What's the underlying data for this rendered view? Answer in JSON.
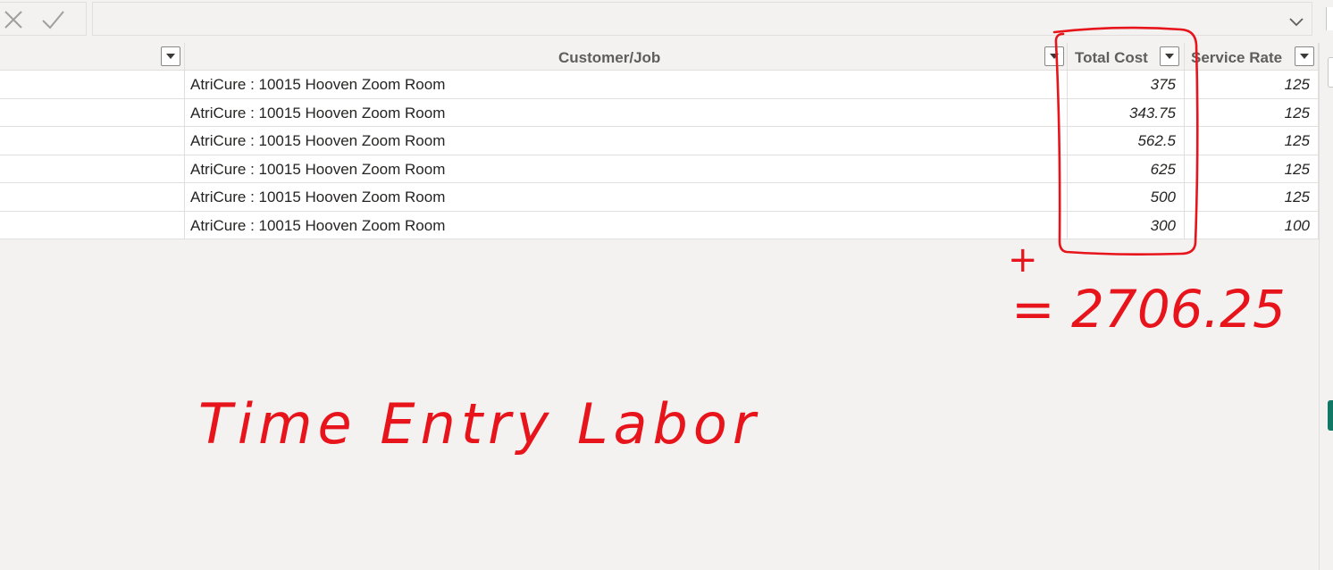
{
  "formula_bar": {
    "cancel_icon": "close-x-icon",
    "commit_icon": "checkmark-icon",
    "expand_icon": "chevron-down-icon",
    "value": ""
  },
  "table": {
    "columns": [
      {
        "label": "",
        "filter_icon": "dropdown-filter-icon"
      },
      {
        "label": "Customer/Job",
        "filter_icon": "dropdown-filter-icon"
      },
      {
        "label": "Total Cost",
        "filter_icon": "dropdown-filter-icon"
      },
      {
        "label": "Service Rate",
        "filter_icon": "dropdown-filter-icon"
      }
    ],
    "rows": [
      {
        "c0": "",
        "customer_job": "AtriCure : 10015 Hooven Zoom Room",
        "total_cost": "375",
        "service_rate": "125"
      },
      {
        "c0": "",
        "customer_job": "AtriCure : 10015 Hooven Zoom Room",
        "total_cost": "343.75",
        "service_rate": "125"
      },
      {
        "c0": "",
        "customer_job": "AtriCure : 10015 Hooven Zoom Room",
        "total_cost": "562.5",
        "service_rate": "125"
      },
      {
        "c0": "",
        "customer_job": "AtriCure : 10015 Hooven Zoom Room",
        "total_cost": "625",
        "service_rate": "125"
      },
      {
        "c0": "",
        "customer_job": "AtriCure : 10015 Hooven Zoom Room",
        "total_cost": "500",
        "service_rate": "125"
      },
      {
        "c0": "",
        "customer_job": "AtriCure : 10015 Hooven Zoom Room",
        "total_cost": "300",
        "service_rate": "100"
      }
    ]
  },
  "annotations": {
    "color": "#e8141b",
    "plus_sign": "+",
    "sum_text": "= 2706.25",
    "label_text": "Time Entry Labor"
  },
  "colors": {
    "background": "#f3f2f1",
    "grid_line": "#e1dfdd",
    "header_text": "#605e5c",
    "side_accent": "#117865"
  }
}
